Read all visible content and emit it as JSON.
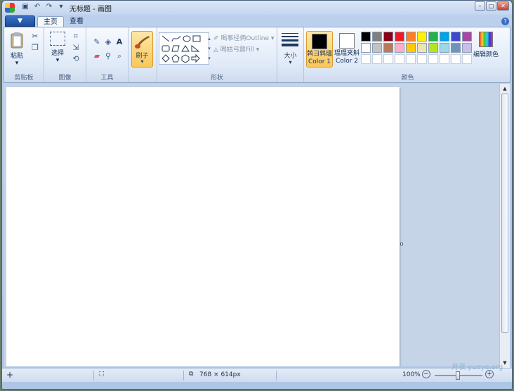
{
  "window": {
    "title": "无标题 - 画图"
  },
  "tabs": {
    "app_menu": "▼",
    "items": [
      {
        "label": "主页"
      },
      {
        "label": "查看"
      }
    ],
    "help": "?"
  },
  "ribbon": {
    "clipboard": {
      "paste": "粘贴",
      "group": "剪贴板"
    },
    "image": {
      "select": "选择",
      "group": "图像"
    },
    "tools": {
      "group": "工具"
    },
    "brushes": {
      "label": "刷子"
    },
    "shapes": {
      "outline": "喝事径俩Outline",
      "fill": "喝姑弓鼐Fill",
      "group": "形状"
    },
    "size": {
      "label": "大小"
    },
    "colors": {
      "color1_cn": "鹁彐鹑瑥",
      "color1": "Color 1",
      "color2_cn": "瑥瑥夹斛",
      "color2": "Color 2",
      "edit": "编辑颜色",
      "group": "颜色",
      "color1_value": "#000000",
      "color2_value": "#ffffff",
      "palette": [
        "#000000",
        "#7f7f7f",
        "#880015",
        "#ed1c24",
        "#ff7f27",
        "#fff200",
        "#22b14c",
        "#00a2e8",
        "#3f48cc",
        "#a349a4",
        "#ffffff",
        "#c3c3c3",
        "#b97a57",
        "#ffaec9",
        "#ffc90e",
        "#efe4b0",
        "#b5e61d",
        "#99d9ea",
        "#7092be",
        "#c8bfe7",
        "#ffffff",
        "#ffffff",
        "#ffffff",
        "#ffffff",
        "#ffffff",
        "#ffffff",
        "#ffffff",
        "#ffffff",
        "#ffffff",
        "#ffffff"
      ]
    }
  },
  "status": {
    "dimensions": "768 × 614px",
    "zoom": "100%"
  },
  "watermark": "月夜 yueye.org"
}
